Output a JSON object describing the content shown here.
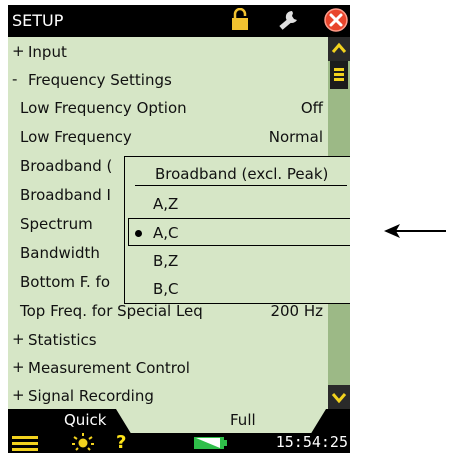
{
  "titlebar": {
    "title": "SETUP"
  },
  "list": [
    {
      "type": "group",
      "expander": "+",
      "label": "Input"
    },
    {
      "type": "group",
      "expander": "-",
      "label": "Frequency Settings"
    },
    {
      "type": "item",
      "label": "Low Frequency Option",
      "value": "Off"
    },
    {
      "type": "item",
      "label": "Low Frequency",
      "value": "Normal"
    },
    {
      "type": "item",
      "label": "Broadband (",
      "value": ""
    },
    {
      "type": "item",
      "label": "Broadband I",
      "value": ""
    },
    {
      "type": "item",
      "label": "Spectrum",
      "value": ""
    },
    {
      "type": "item",
      "label": "Bandwidth",
      "value": ""
    },
    {
      "type": "item",
      "label": "Bottom F. fo",
      "value": ""
    },
    {
      "type": "item",
      "label": "Top Freq. for Special Leq",
      "value": "200 Hz"
    },
    {
      "type": "group",
      "expander": "+",
      "label": "Statistics"
    },
    {
      "type": "group",
      "expander": "+",
      "label": "Measurement Control"
    },
    {
      "type": "group",
      "expander": "+",
      "label": "Signal Recording"
    }
  ],
  "popup": {
    "title": "Broadband (excl. Peak)",
    "options": [
      "A,Z",
      "A,C",
      "B,Z",
      "B,C"
    ],
    "selected_index": 1
  },
  "tabs": {
    "quick": "Quick",
    "full": "Full",
    "active": "full"
  },
  "statusbar": {
    "clock": "15:54:25"
  },
  "icons": [
    "lock-icon",
    "wrench-icon",
    "close-icon",
    "menu-icon",
    "light-icon",
    "help-icon",
    "battery-icon"
  ],
  "colors": {
    "background": "#d6e6c6",
    "bar": "#000000",
    "close": "#e8452c",
    "lock": "#f2c230",
    "light": "#f2d21e",
    "help": "#ffe51a",
    "battery": "#2fbf4a"
  }
}
